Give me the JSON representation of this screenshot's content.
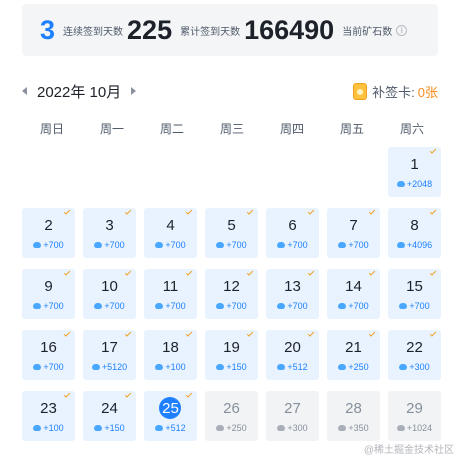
{
  "stats": [
    {
      "value": "3",
      "label": "连续签到天数"
    },
    {
      "value": "225",
      "label": "累计签到天数"
    },
    {
      "value": "166490",
      "label": "当前矿石数"
    }
  ],
  "calendar": {
    "month_title": "2022年 10月",
    "makeup_label": "补签卡:",
    "makeup_count": "0张",
    "weekdays": [
      "周日",
      "周一",
      "周二",
      "周三",
      "周四",
      "周五",
      "周六"
    ],
    "days": [
      {
        "day": "1",
        "reward": "+2048",
        "state": "done"
      },
      {
        "day": "2",
        "reward": "+700",
        "state": "done"
      },
      {
        "day": "3",
        "reward": "+700",
        "state": "done"
      },
      {
        "day": "4",
        "reward": "+700",
        "state": "done"
      },
      {
        "day": "5",
        "reward": "+700",
        "state": "done"
      },
      {
        "day": "6",
        "reward": "+700",
        "state": "done"
      },
      {
        "day": "7",
        "reward": "+700",
        "state": "done"
      },
      {
        "day": "8",
        "reward": "+4096",
        "state": "done"
      },
      {
        "day": "9",
        "reward": "+700",
        "state": "done"
      },
      {
        "day": "10",
        "reward": "+700",
        "state": "done"
      },
      {
        "day": "11",
        "reward": "+700",
        "state": "done"
      },
      {
        "day": "12",
        "reward": "+700",
        "state": "done"
      },
      {
        "day": "13",
        "reward": "+700",
        "state": "done"
      },
      {
        "day": "14",
        "reward": "+700",
        "state": "done"
      },
      {
        "day": "15",
        "reward": "+700",
        "state": "done"
      },
      {
        "day": "16",
        "reward": "+700",
        "state": "done"
      },
      {
        "day": "17",
        "reward": "+5120",
        "state": "done"
      },
      {
        "day": "18",
        "reward": "+100",
        "state": "done"
      },
      {
        "day": "19",
        "reward": "+150",
        "state": "done"
      },
      {
        "day": "20",
        "reward": "+512",
        "state": "done"
      },
      {
        "day": "21",
        "reward": "+250",
        "state": "done"
      },
      {
        "day": "22",
        "reward": "+300",
        "state": "done"
      },
      {
        "day": "23",
        "reward": "+100",
        "state": "done"
      },
      {
        "day": "24",
        "reward": "+150",
        "state": "done"
      },
      {
        "day": "25",
        "reward": "+512",
        "state": "today"
      },
      {
        "day": "26",
        "reward": "+250",
        "state": "future"
      },
      {
        "day": "27",
        "reward": "+300",
        "state": "future"
      },
      {
        "day": "28",
        "reward": "+350",
        "state": "future"
      },
      {
        "day": "29",
        "reward": "+1024",
        "state": "future"
      }
    ]
  },
  "watermark": "@稀土掘金技术社区",
  "colors": {
    "accent": "#1e80ff",
    "done_bg": "#e8f3ff",
    "future_bg": "#f2f3f5",
    "check": "#f0a020",
    "makeup": "#f78b1e"
  },
  "icons": [
    "info-icon",
    "chevron-left-icon",
    "chevron-right-icon",
    "makeup-card-icon",
    "ore-icon",
    "check-icon"
  ]
}
